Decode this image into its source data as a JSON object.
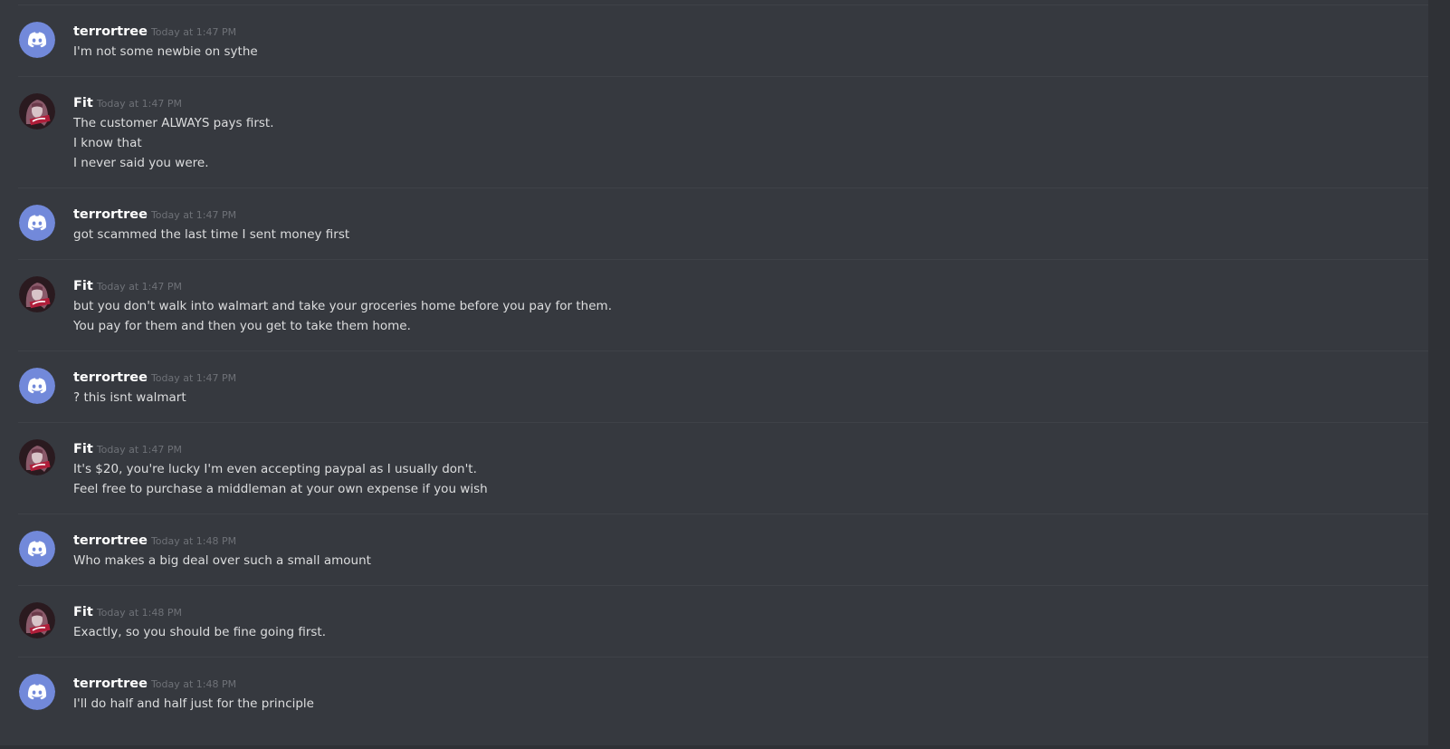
{
  "messages": [
    {
      "author": "terrortree",
      "timestamp": "Today at 1:47 PM",
      "avatar": "discord-logo-icon",
      "lines": [
        "I'm not some newbie on sythe"
      ]
    },
    {
      "author": "Fit",
      "timestamp": "Today at 1:47 PM",
      "avatar": "user-photo-avatar",
      "lines": [
        "The customer ALWAYS pays first.",
        "I know that",
        "I never said you were."
      ]
    },
    {
      "author": "terrortree",
      "timestamp": "Today at 1:47 PM",
      "avatar": "discord-logo-icon",
      "lines": [
        "got scammed the last time I sent money first"
      ]
    },
    {
      "author": "Fit",
      "timestamp": "Today at 1:47 PM",
      "avatar": "user-photo-avatar",
      "lines": [
        "but you don't walk into walmart and take your groceries home before you pay for them.",
        "You pay for them and then you get to take them home."
      ]
    },
    {
      "author": "terrortree",
      "timestamp": "Today at 1:47 PM",
      "avatar": "discord-logo-icon",
      "lines": [
        "?  this isnt walmart"
      ]
    },
    {
      "author": "Fit",
      "timestamp": "Today at 1:47 PM",
      "avatar": "user-photo-avatar",
      "lines": [
        "It's $20, you're lucky I'm even accepting paypal as I usually don't.",
        "Feel free to purchase a middleman at your own expense if you wish"
      ]
    },
    {
      "author": "terrortree",
      "timestamp": "Today at 1:48 PM",
      "avatar": "discord-logo-icon",
      "lines": [
        "Who makes a big deal over such a small amount"
      ]
    },
    {
      "author": "Fit",
      "timestamp": "Today at 1:48 PM",
      "avatar": "user-photo-avatar",
      "lines": [
        "Exactly, so you should be fine going first."
      ]
    },
    {
      "author": "terrortree",
      "timestamp": "Today at 1:48 PM",
      "avatar": "discord-logo-icon",
      "lines": [
        "I'll do half and half just for the principle"
      ]
    }
  ],
  "colors": {
    "background": "#36393f",
    "username": "#ffffff",
    "timestamp": "#6e7177",
    "text": "#dcddde",
    "discord_blurple": "#7289da"
  }
}
